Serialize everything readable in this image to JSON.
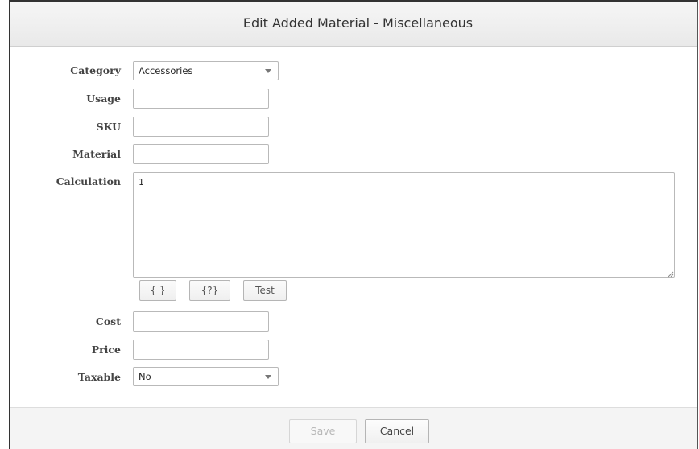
{
  "dialog": {
    "title": "Edit Added Material - Miscellaneous"
  },
  "form": {
    "category": {
      "label": "Category",
      "value": "Accessories"
    },
    "usage": {
      "label": "Usage",
      "value": ""
    },
    "sku": {
      "label": "SKU",
      "value": ""
    },
    "material": {
      "label": "Material",
      "value": ""
    },
    "calculation": {
      "label": "Calculation",
      "value": "1"
    },
    "calc_buttons": {
      "braces": "{ }",
      "help_braces": "{?}",
      "test": "Test"
    },
    "cost": {
      "label": "Cost",
      "value": ""
    },
    "price": {
      "label": "Price",
      "value": ""
    },
    "taxable": {
      "label": "Taxable",
      "value": "No"
    }
  },
  "footer": {
    "save_label": "Save",
    "cancel_label": "Cancel",
    "save_enabled": false
  },
  "colors": {
    "title_bar_bg": "#eeeeee",
    "footer_bg": "#f4f4f4",
    "border": "#b9b9b9",
    "disabled_text": "#b8b8b8"
  },
  "icons": {
    "select_arrow": "chevron-down-icon",
    "textarea_resize": "resize-grip-icon"
  }
}
